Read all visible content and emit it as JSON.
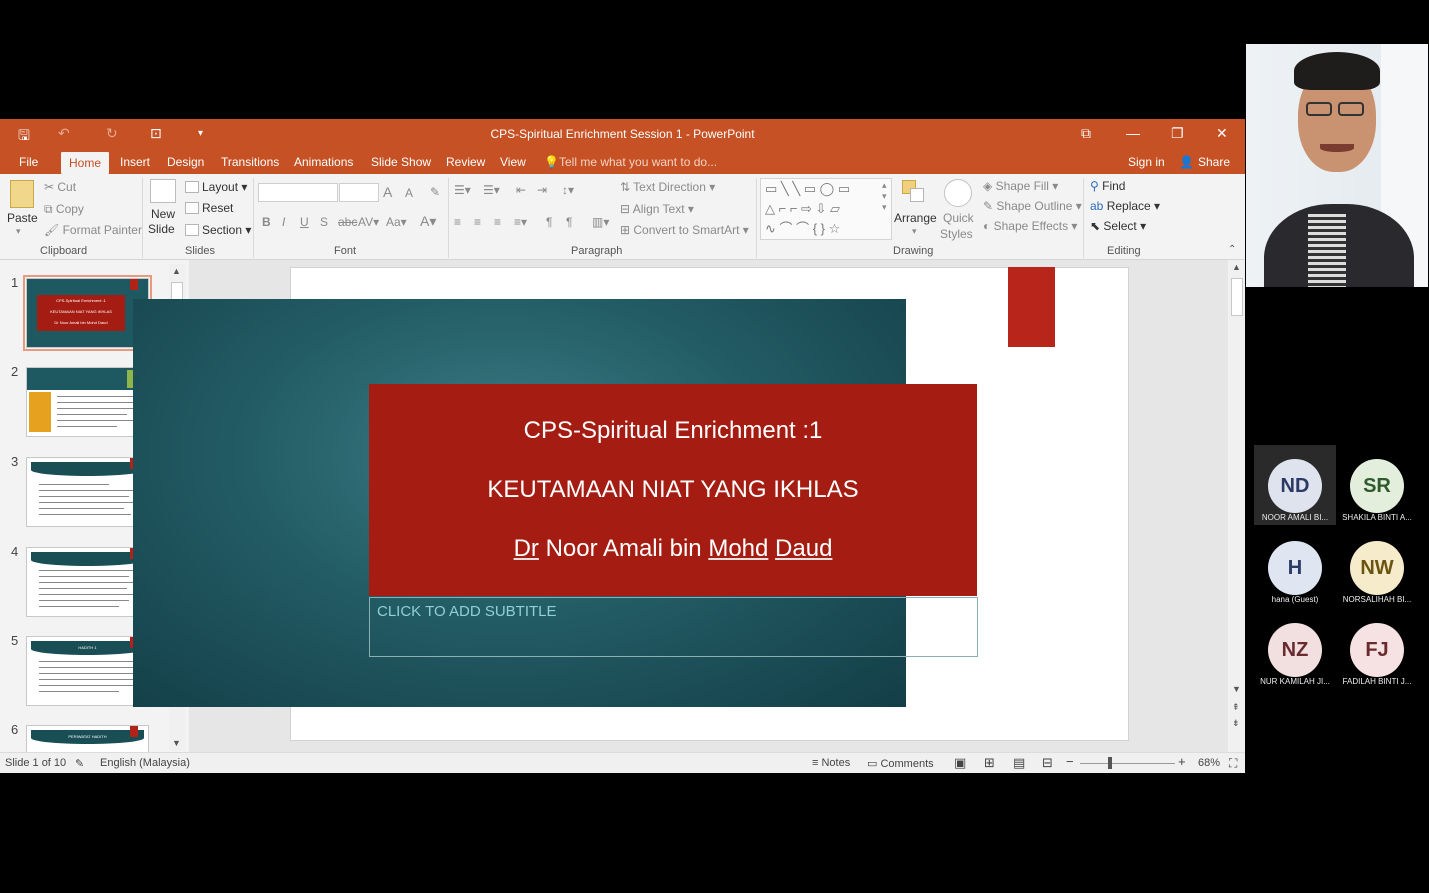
{
  "window": {
    "title": "CPS-Spiritual Enrichment Session 1 - PowerPoint"
  },
  "tabs": [
    {
      "label": "File"
    },
    {
      "label": "Home"
    },
    {
      "label": "Insert"
    },
    {
      "label": "Design"
    },
    {
      "label": "Transitions"
    },
    {
      "label": "Animations"
    },
    {
      "label": "Slide Show"
    },
    {
      "label": "Review"
    },
    {
      "label": "View"
    }
  ],
  "tell_me": "Tell me what you want to do...",
  "sign_in": "Sign in",
  "share": "Share",
  "ribbon": {
    "clipboard": {
      "label": "Clipboard",
      "paste": "Paste",
      "cut": "Cut",
      "copy": "Copy",
      "format_painter": "Format Painter"
    },
    "slides": {
      "label": "Slides",
      "new_slide_1": "New",
      "new_slide_2": "Slide",
      "layout": "Layout",
      "reset": "Reset",
      "section": "Section"
    },
    "font": {
      "label": "Font"
    },
    "paragraph": {
      "label": "Paragraph",
      "text_direction": "Text Direction",
      "align_text": "Align Text",
      "convert_smartart": "Convert to SmartArt"
    },
    "drawing": {
      "label": "Drawing",
      "arrange": "Arrange",
      "quick_styles_1": "Quick",
      "quick_styles_2": "Styles",
      "shape_fill": "Shape Fill",
      "shape_outline": "Shape Outline",
      "shape_effects": "Shape Effects"
    },
    "editing": {
      "label": "Editing",
      "find": "Find",
      "replace": "Replace",
      "select": "Select"
    }
  },
  "thumbnails": [
    {
      "num": "1"
    },
    {
      "num": "2"
    },
    {
      "num": "3"
    },
    {
      "num": "4"
    },
    {
      "num": "5"
    },
    {
      "num": "6"
    }
  ],
  "thumb_text": {
    "t1_a": "CPS-Spiritual Enrichment :1",
    "t1_b": "KEUTAMAAN NIAT YANG IKHLAS",
    "t1_c": "Dr Noor Amali bin Mohd Daud",
    "t5": "HADITH 1",
    "t6": "PERIWATAT HADITH"
  },
  "slide": {
    "line1": "CPS-Spiritual Enrichment :1",
    "line2": "KEUTAMAAN NIAT YANG IKHLAS",
    "line3_a": "Dr",
    "line3_b": "Noor Amali bin",
    "line3_c": "Mohd",
    "line3_d": "Daud",
    "subtitle": "CLICK TO ADD SUBTITLE"
  },
  "status": {
    "slide_count": "Slide 1 of 10",
    "language": "English (Malaysia)",
    "notes": "Notes",
    "comments": "Comments",
    "zoom": "68%"
  },
  "participants": [
    {
      "initials": "ND",
      "name": "NOOR AMALI BI...",
      "color": "#dfe3ee",
      "text_color": "#2b3a66"
    },
    {
      "initials": "SR",
      "name": "SHAKILA BINTI A...",
      "color": "#e3efdc",
      "text_color": "#2e5a2e"
    },
    {
      "initials": "H",
      "name": "hana (Guest)",
      "color": "#dfe6f2",
      "text_color": "#2b3a66"
    },
    {
      "initials": "NW",
      "name": "NORSALIHAH BI...",
      "color": "#f6eccc",
      "text_color": "#6a5510"
    },
    {
      "initials": "NZ",
      "name": "NUR KAMILAH JI...",
      "color": "#f2dfe0",
      "text_color": "#6a2b2e"
    },
    {
      "initials": "FJ",
      "name": "FADILAH BINTI J...",
      "color": "#f6e2e2",
      "text_color": "#6a2b2e"
    }
  ],
  "colors": {
    "accent": "#c55124",
    "slide_red": "#a51d12",
    "slide_teal": "#235c65"
  }
}
